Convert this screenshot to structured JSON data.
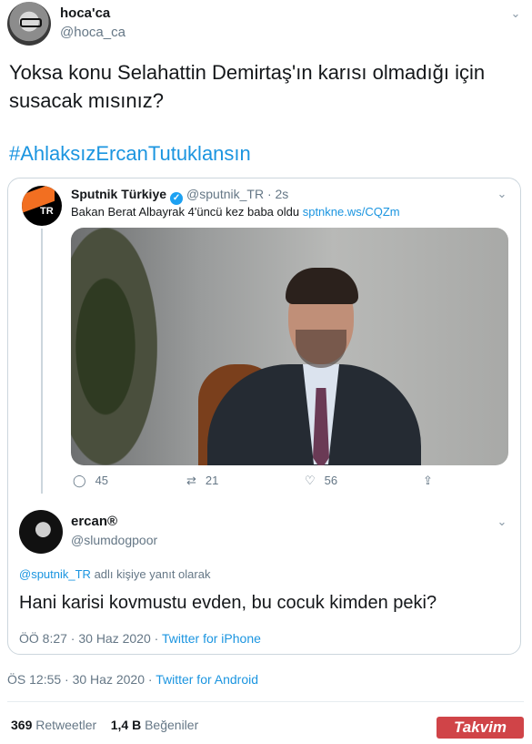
{
  "tweet": {
    "author_name": "hoca'ca",
    "author_handle": "@hoca_ca",
    "text": "Yoksa konu Selahattin Demirtaş'ın karısı olmadığı için susacak mısınız?",
    "hashtag": "#AhlaksızErcanTutuklansın",
    "timestamp": "ÖS 12:55 · 30 Haz 2020 · ",
    "source": "Twitter for Android",
    "retweets_count": "369",
    "retweets_label": "Retweetler",
    "likes_count": "1,4 B",
    "likes_label": "Beğeniler"
  },
  "quoted_tweet": {
    "author_name": "Sputnik Türkiye",
    "author_handle": "@sputnik_TR · 2s",
    "avatar_text": "TR",
    "text": "Bakan Berat Albayrak 4'üncü kez baba oldu ",
    "link": "sptnkne.ws/CQZm",
    "replies": "45",
    "retweets": "21",
    "likes": "56"
  },
  "reply_tweet": {
    "author_name": "ercan®",
    "author_handle": "@slumdogpoor",
    "reply_mention": "@sputnik_TR",
    "reply_label": " adlı kişiye yanıt olarak",
    "text": "Hani karisi kovmustu evden, bu cocuk kimden peki?",
    "timestamp": "ÖÖ 8:27 · 30 Haz 2020 · ",
    "source": "Twitter for iPhone"
  },
  "watermark": "Takvim",
  "icons": {
    "chevron": "⌄",
    "verified": "✓",
    "reply": "◯",
    "retweet": "⇄",
    "like": "♡",
    "share": "⇪"
  },
  "colors": {
    "link": "#1b95e0",
    "muted": "#657786",
    "border": "#ccd6dd"
  }
}
